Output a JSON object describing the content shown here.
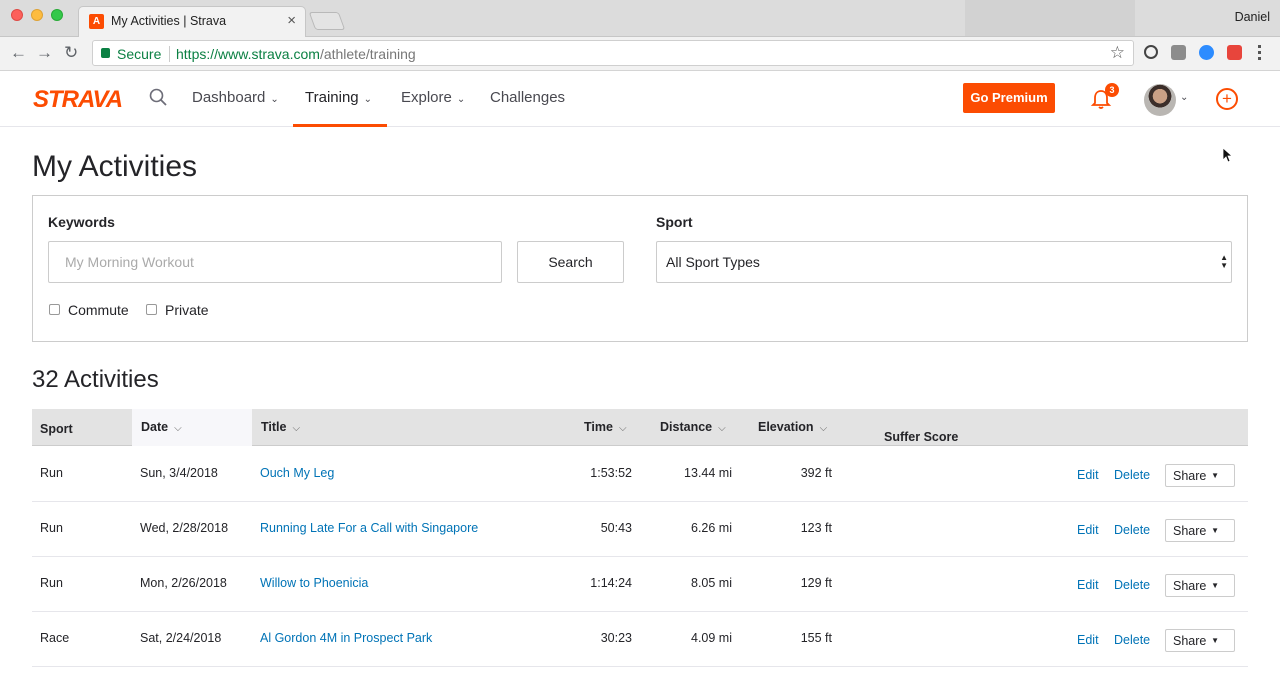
{
  "browser": {
    "tab_title": "My Activities | Strava",
    "tab_close": "×",
    "favicon_letter": "A",
    "profile_name": "Daniel",
    "secure_label": "Secure",
    "url_scheme_host": "https://www.strava.com",
    "url_path": "/athlete/training",
    "nav_back": "←",
    "nav_forward": "→",
    "nav_reload": "↻",
    "star": "☆"
  },
  "header": {
    "logo": "STRAVA",
    "nav": [
      {
        "label": "Dashboard",
        "chevron": "⌄"
      },
      {
        "label": "Training",
        "chevron": "⌄"
      },
      {
        "label": "Explore",
        "chevron": "⌄"
      },
      {
        "label": "Challenges"
      }
    ],
    "premium_label": "Go Premium",
    "notification_count": "3",
    "avatar_chevron": "⌄",
    "add_symbol": "+",
    "accent": "#fc4c02"
  },
  "page": {
    "title": "My Activities",
    "filters": {
      "keywords_label": "Keywords",
      "keywords_placeholder": "My Morning Workout",
      "search_label": "Search",
      "sport_label": "Sport",
      "sport_selected": "All Sport Types",
      "commute_label": "Commute",
      "private_label": "Private"
    },
    "count_title": "32 Activities"
  },
  "table": {
    "headers": {
      "sport": "Sport",
      "date": "Date",
      "title": "Title",
      "time": "Time",
      "distance": "Distance",
      "elevation": "Elevation",
      "suffer": "Suffer Score",
      "sort_icon": "⌵"
    },
    "actions": {
      "edit": "Edit",
      "delete": "Delete",
      "share": "Share",
      "caret": "▼"
    },
    "rows": [
      {
        "sport": "Run",
        "date": "Sun, 3/4/2018",
        "title": "Ouch My Leg",
        "time": "1:53:52",
        "distance": "13.44 mi",
        "elevation": "392 ft"
      },
      {
        "sport": "Run",
        "date": "Wed, 2/28/2018",
        "title": "Running Late For a Call with Singapore",
        "time": "50:43",
        "distance": "6.26 mi",
        "elevation": "123 ft"
      },
      {
        "sport": "Run",
        "date": "Mon, 2/26/2018",
        "title": "Willow to Phoenicia",
        "time": "1:14:24",
        "distance": "8.05 mi",
        "elevation": "129 ft"
      },
      {
        "sport": "Race",
        "date": "Sat, 2/24/2018",
        "title": "Al Gordon 4M in Prospect Park",
        "time": "30:23",
        "distance": "4.09 mi",
        "elevation": "155 ft"
      }
    ]
  }
}
